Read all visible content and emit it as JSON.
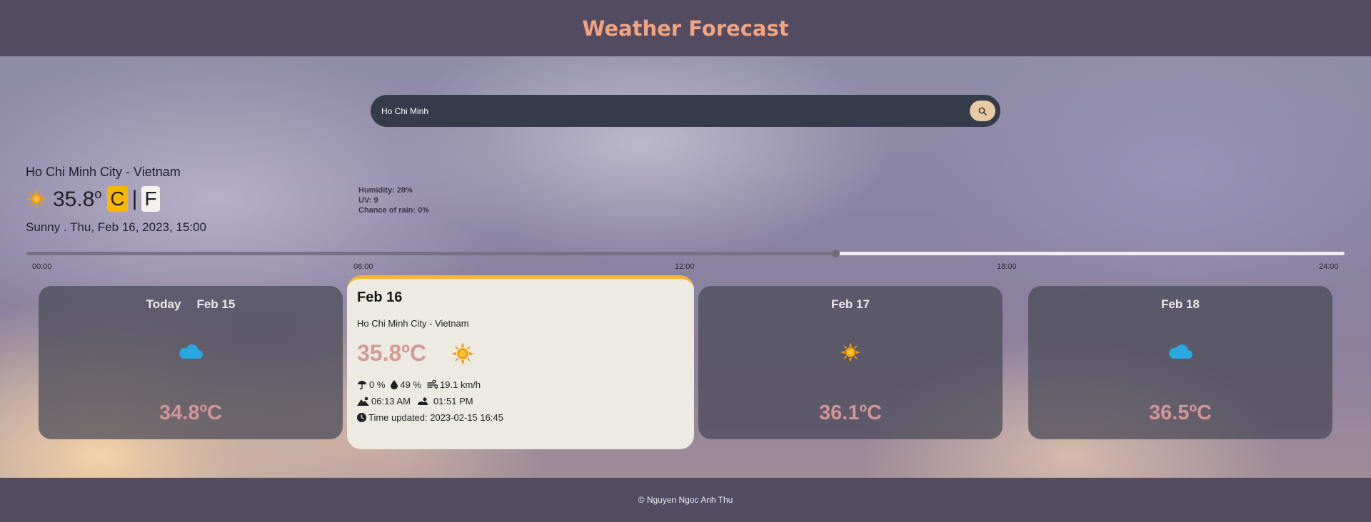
{
  "header": {
    "title": "Weather Forecast"
  },
  "search": {
    "value": "Ho Chi Minh",
    "button_icon": "search-icon"
  },
  "current": {
    "location": "Ho Chi Minh City - Vietnam",
    "temperature": "35.8",
    "degree": "o",
    "unit_c": "C",
    "separator": "|",
    "unit_f": "F",
    "description": "Sunny . Thu, Feb 16, 2023, 15:00",
    "humidity": "Humidity: 28%",
    "uv": "UV: 9",
    "rain_chance": "Chance of rain: 0%",
    "icon": "sun-icon"
  },
  "timeline": {
    "ticks": [
      "00:00",
      "06:00",
      "12:00",
      "18:00",
      "24:00"
    ],
    "progress": 0.614
  },
  "cards": [
    {
      "today": "Today",
      "date": "Feb 15",
      "icon": "cloud-icon",
      "temp": "34.8ºC"
    },
    {
      "date": "Feb 17",
      "icon": "sun-icon",
      "temp": "36.1ºC"
    },
    {
      "date": "Feb 18",
      "icon": "cloud-icon",
      "temp": "36.5ºC"
    }
  ],
  "selected_day": {
    "date": "Feb 16",
    "location": "Ho Chi Minh City - Vietnam",
    "temp": "35.8ºC",
    "rain": "0 %",
    "humidity": "49 %",
    "wind": "19.1 km/h",
    "sunrise": "06:13 AM",
    "sunset": "01:51 PM",
    "updated": "Time updated: 2023-02-15 16:45"
  },
  "footer": {
    "text": "© Nguyen Ngoc Anh Thu"
  },
  "colors": {
    "header_bg": "#524b62",
    "title": "#f2a57e",
    "unit_active": "#f8b800",
    "card_temp": "#d3949a",
    "accent_top": "#f7b536",
    "cloud": "#29a8e0",
    "sun": "#f39c12"
  }
}
